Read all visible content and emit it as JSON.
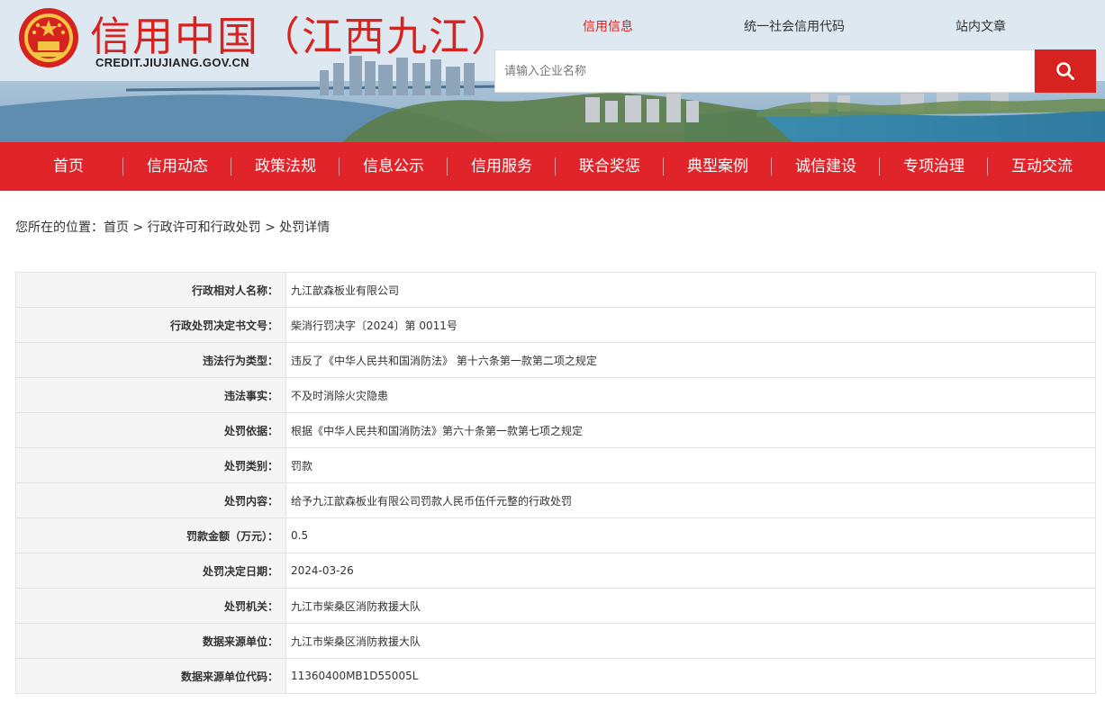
{
  "header": {
    "title": "信用中国（江西九江）",
    "domain": "CREDIT.JIUJIANG.GOV.CN",
    "top_links": [
      "信用信息",
      "统一社会信用代码",
      "站内文章"
    ],
    "active_top_link": "信用信息",
    "search_placeholder": "请输入企业名称",
    "search_icon": "search-icon",
    "brand_color": "#d7231f"
  },
  "nav": {
    "items": [
      "首页",
      "信用动态",
      "政策法规",
      "信息公示",
      "信用服务",
      "联合奖惩",
      "典型案例",
      "诚信建设",
      "专项治理",
      "互动交流"
    ],
    "bg_color": "#e0242a"
  },
  "breadcrumb": {
    "prefix": "您所在的位置：",
    "items": [
      "首页",
      "行政许可和行政处罚",
      "处罚详情"
    ],
    "separator": " > "
  },
  "detail": {
    "rows": [
      {
        "label": "行政相对人名称：",
        "value": "九江歆森板业有限公司"
      },
      {
        "label": "行政处罚决定书文号：",
        "value": "柴消行罚决字〔2024〕第 0011号"
      },
      {
        "label": "违法行为类型：",
        "value": "违反了《中华人民共和国消防法》 第十六条第一款第二项之规定"
      },
      {
        "label": "违法事实：",
        "value": "不及时消除火灾隐患"
      },
      {
        "label": "处罚依据：",
        "value": "根据《中华人民共和国消防法》第六十条第一款第七项之规定"
      },
      {
        "label": "处罚类别：",
        "value": "罚款"
      },
      {
        "label": "处罚内容：",
        "value": "给予九江歆森板业有限公司罚款人民币伍仟元整的行政处罚"
      },
      {
        "label": "罚款金额（万元）：",
        "value": "0.5"
      },
      {
        "label": "处罚决定日期：",
        "value": "2024-03-26"
      },
      {
        "label": "处罚机关：",
        "value": "九江市柴桑区消防救援大队"
      },
      {
        "label": "数据来源单位：",
        "value": "九江市柴桑区消防救援大队"
      },
      {
        "label": "数据来源单位代码：",
        "value": "11360400MB1D55005L"
      }
    ]
  }
}
